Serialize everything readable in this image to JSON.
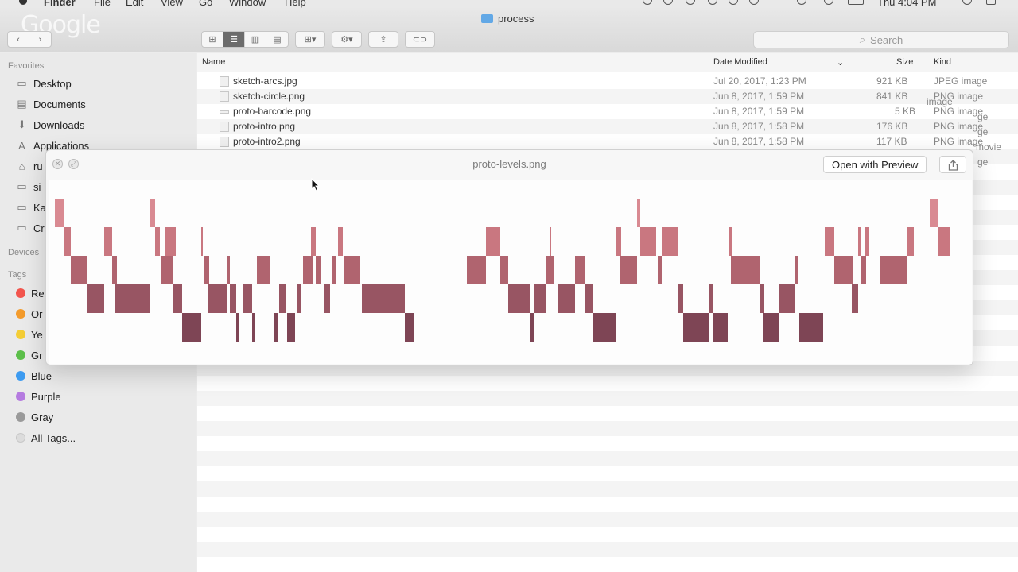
{
  "menubar": {
    "app": "Finder",
    "items": [
      "File",
      "Edit",
      "View",
      "Go",
      "Window",
      "Help"
    ],
    "clock": "Thu 4:04 PM"
  },
  "window": {
    "title": "process",
    "logo": "Google",
    "search_placeholder": "Search",
    "view_buttons": [
      "icon-view-icon",
      "list-view-icon",
      "column-view-icon",
      "cover-flow-icon"
    ],
    "active_view": "list-view-icon"
  },
  "sidebar": {
    "favorites_header": "Favorites",
    "favorites": [
      {
        "label": "Desktop",
        "icon": "desktop-icon"
      },
      {
        "label": "Documents",
        "icon": "documents-icon"
      },
      {
        "label": "Downloads",
        "icon": "downloads-icon"
      },
      {
        "label": "Applications",
        "icon": "applications-icon"
      },
      {
        "label": "ru",
        "icon": "home-icon"
      },
      {
        "label": "si",
        "icon": "folder-icon"
      },
      {
        "label": "Ka",
        "icon": "folder-icon"
      },
      {
        "label": "Cr",
        "icon": "folder-icon"
      }
    ],
    "devices_header": "Devices",
    "tags_header": "Tags",
    "tags": [
      {
        "label": "Re",
        "color": "#f2554d"
      },
      {
        "label": "Or",
        "color": "#f39b2c"
      },
      {
        "label": "Ye",
        "color": "#f4cd36"
      },
      {
        "label": "Gr",
        "color": "#5cbf4a"
      },
      {
        "label": "Blue",
        "color": "#3d9bf0"
      },
      {
        "label": "Purple",
        "color": "#b57be0"
      },
      {
        "label": "Gray",
        "color": "#9a9a9a"
      },
      {
        "label": "All Tags...",
        "color": "#dcdcdc"
      }
    ]
  },
  "list": {
    "columns": [
      "Name",
      "Date Modified",
      "Size",
      "Kind"
    ],
    "rows": [
      {
        "name": "sketch-arcs.jpg",
        "date": "Jul 20, 2017, 1:23 PM",
        "size": "921 KB",
        "kind": "JPEG image"
      },
      {
        "name": "sketch-circle.png",
        "date": "Jun 8, 2017, 1:59 PM",
        "size": "841 KB",
        "kind": "PNG image"
      },
      {
        "name": "proto-barcode.png",
        "date": "Jun 8, 2017, 1:59 PM",
        "size": "5 KB",
        "kind": "PNG image"
      },
      {
        "name": "proto-intro.png",
        "date": "Jun 8, 2017, 1:58 PM",
        "size": "176 KB",
        "kind": "PNG image"
      },
      {
        "name": "proto-intro2.png",
        "date": "Jun 8, 2017, 1:58 PM",
        "size": "117 KB",
        "kind": "PNG image"
      }
    ],
    "peek_kinds": [
      "image",
      "ge",
      "ge",
      "movie",
      "ge"
    ]
  },
  "quicklook": {
    "title": "proto-levels.png",
    "open_button": "Open with Preview",
    "share_icon": "share-icon"
  }
}
